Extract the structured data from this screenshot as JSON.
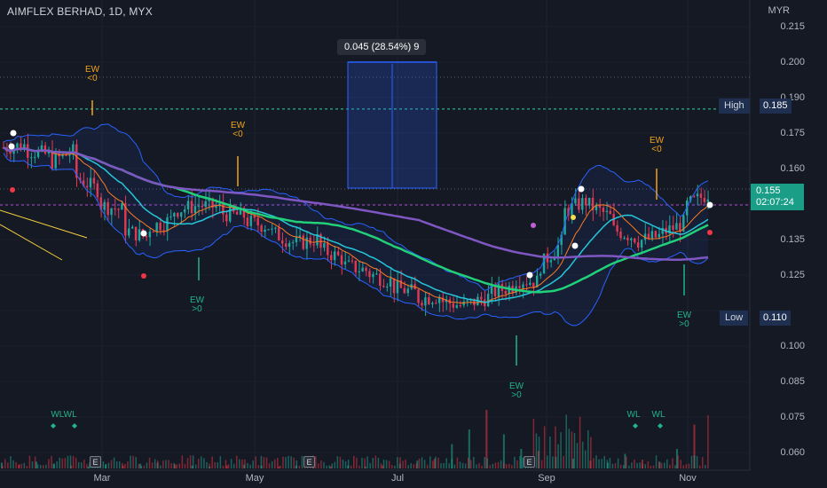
{
  "chart_data": {
    "type": "candlestick",
    "title": "AIMFLEX BERHAD, 1D, MYX",
    "currency": "MYR",
    "y_ticks": [
      "0.215",
      "0.200",
      "0.190",
      "0.175",
      "0.160",
      "0.135",
      "0.125",
      "0.100",
      "0.085",
      "0.075",
      "0.060"
    ],
    "x_ticks": [
      "Mar",
      "May",
      "Jul",
      "Sep",
      "Nov"
    ],
    "ylim": [
      0.055,
      0.222
    ],
    "last_price": "0.155",
    "countdown": "02:07:24",
    "high": {
      "label": "High",
      "value": "0.185"
    },
    "low": {
      "label": "Low",
      "value": "0.110"
    },
    "measure_label": "0.045 (28.54%) 9",
    "ew_labels": [
      {
        "top": "EW",
        "bot": "<0"
      },
      {
        "top": "EW",
        "bot": "<0"
      },
      {
        "top": "EW",
        "bot": "<0"
      },
      {
        "top": "EW",
        "bot": ">0"
      },
      {
        "top": "EW",
        "bot": ">0"
      },
      {
        "top": "EW",
        "bot": ">0"
      }
    ],
    "wl_labels": [
      "WLWL",
      "WL",
      "WL"
    ],
    "earnings_badge": "E",
    "price_path": [
      [
        0.171,
        0.172
      ],
      [
        0.17,
        0.168
      ],
      [
        0.166,
        0.17
      ],
      [
        0.16,
        0.155
      ],
      [
        0.15,
        0.148
      ],
      [
        0.141,
        0.138
      ],
      [
        0.142,
        0.145
      ],
      [
        0.148,
        0.15
      ],
      [
        0.15,
        0.149
      ],
      [
        0.147,
        0.146
      ],
      [
        0.144,
        0.142
      ],
      [
        0.14,
        0.136
      ],
      [
        0.136,
        0.138
      ],
      [
        0.134,
        0.13
      ],
      [
        0.128,
        0.126
      ],
      [
        0.125,
        0.122
      ],
      [
        0.12,
        0.118
      ],
      [
        0.116,
        0.117
      ],
      [
        0.115,
        0.113
      ],
      [
        0.114,
        0.117
      ],
      [
        0.118,
        0.121
      ],
      [
        0.123,
        0.122
      ],
      [
        0.128,
        0.138
      ],
      [
        0.148,
        0.152
      ],
      [
        0.15,
        0.145
      ],
      [
        0.141,
        0.138
      ],
      [
        0.137,
        0.139
      ],
      [
        0.14,
        0.144
      ],
      [
        0.15,
        0.155
      ]
    ],
    "volume": [
      6,
      4,
      7,
      5,
      3,
      2,
      4,
      3,
      5,
      6,
      4,
      3,
      2,
      3,
      4,
      3,
      2,
      3,
      4,
      2,
      3,
      2,
      3,
      5,
      8,
      10,
      25,
      40,
      60,
      35,
      20,
      18,
      12,
      10,
      8,
      6,
      15,
      9,
      7,
      20,
      45
    ]
  }
}
